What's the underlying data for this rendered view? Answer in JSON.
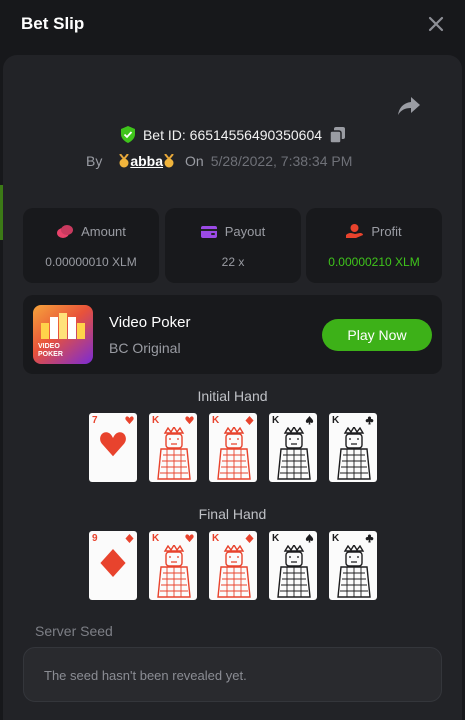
{
  "header": {
    "title": "Bet Slip"
  },
  "bet": {
    "id_label": "Bet ID: 66514556490350604",
    "by_label": "By",
    "user": "abba",
    "on_label": "On",
    "date": "5/28/2022, 7:38:34 PM"
  },
  "stats": [
    {
      "label": "Amount",
      "value": "0.00000010 XLM",
      "icon": "coins-icon"
    },
    {
      "label": "Payout",
      "value": "22 x",
      "icon": "wallet-icon"
    },
    {
      "label": "Profit",
      "value": "0.00000210 XLM",
      "icon": "profit-hand-icon"
    }
  ],
  "game": {
    "name": "Video Poker",
    "sub": "BC Original",
    "thumb_text_line1": "VIDEO",
    "thumb_text_line2": "POKER",
    "play_label": "Play Now"
  },
  "initial_hand": {
    "title": "Initial Hand",
    "cards": [
      {
        "rank": "7",
        "suit": "hearts"
      },
      {
        "rank": "K",
        "suit": "hearts"
      },
      {
        "rank": "K",
        "suit": "diamonds"
      },
      {
        "rank": "K",
        "suit": "spades"
      },
      {
        "rank": "K",
        "suit": "clubs"
      }
    ]
  },
  "final_hand": {
    "title": "Final Hand",
    "cards": [
      {
        "rank": "9",
        "suit": "diamonds"
      },
      {
        "rank": "K",
        "suit": "hearts"
      },
      {
        "rank": "K",
        "suit": "diamonds"
      },
      {
        "rank": "K",
        "suit": "spades"
      },
      {
        "rank": "K",
        "suit": "clubs"
      }
    ]
  },
  "seed": {
    "label": "Server Seed",
    "text": "The seed hasn't been revealed yet."
  },
  "colors": {
    "background": "#17181b",
    "panel": "#222327",
    "accent_green": "#3db118",
    "profit_green": "#3fc41b",
    "card_red": "#e8432d"
  }
}
